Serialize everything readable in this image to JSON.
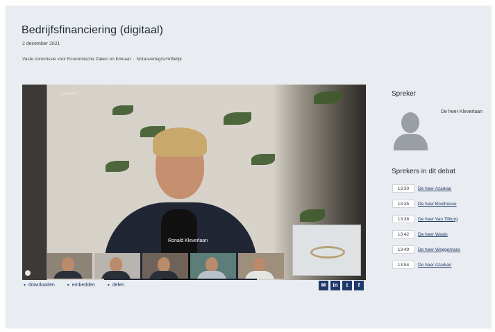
{
  "header": {
    "title": "Bedrijfsfinanciering (digitaal)",
    "date": "2 december 2021",
    "committee": "Vaste commissie voor Economische Zaken en Klimaat",
    "separator": "·",
    "type": "Notaoverleg/schriftelijk"
  },
  "player": {
    "paused_label": "[ pauze ]",
    "current_speaker_overlay": "Ronald Kleverlaan"
  },
  "actions": {
    "download": "downloaden",
    "embed": "embedden",
    "share": "delen"
  },
  "social": [
    {
      "icon": "email-icon",
      "glyph": "✉"
    },
    {
      "icon": "linkedin-icon",
      "glyph": "in"
    },
    {
      "icon": "twitter-icon",
      "glyph": "t"
    },
    {
      "icon": "facebook-icon",
      "glyph": "f"
    }
  ],
  "sidebar": {
    "speaker_heading": "Spreker",
    "current_speaker": "De heer Kleverlaan",
    "debate_heading": "Sprekers in dit debat",
    "speakers": [
      {
        "time": "13:30",
        "name": "De heer Azarkan"
      },
      {
        "time": "13:35",
        "name": "De heer Bosthouse"
      },
      {
        "time": "13:38",
        "name": "De heer Van Tilburg"
      },
      {
        "time": "13:42",
        "name": "De heer Wasin"
      },
      {
        "time": "13:49",
        "name": "De heer Weggemans"
      },
      {
        "time": "13:54",
        "name": "De heer Azarkan"
      }
    ]
  },
  "colors": {
    "accent": "#1f3a6b",
    "page_bg": "#e9ecf0"
  }
}
